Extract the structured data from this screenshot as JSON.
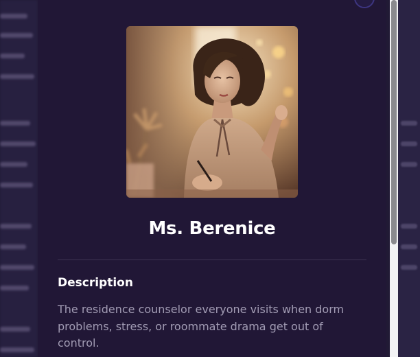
{
  "character": {
    "name": "Ms. Berenice",
    "portrait_alt": "portrait"
  },
  "description": {
    "heading": "Description",
    "text": "The residence counselor everyone visits when dorm problems, stress, or roommate drama get out of control."
  },
  "colors": {
    "modal_bg": "#211736",
    "page_bg": "#211a35",
    "heading": "#ffffff",
    "body_text": "#a29cb4",
    "divider": "#3d3452"
  }
}
